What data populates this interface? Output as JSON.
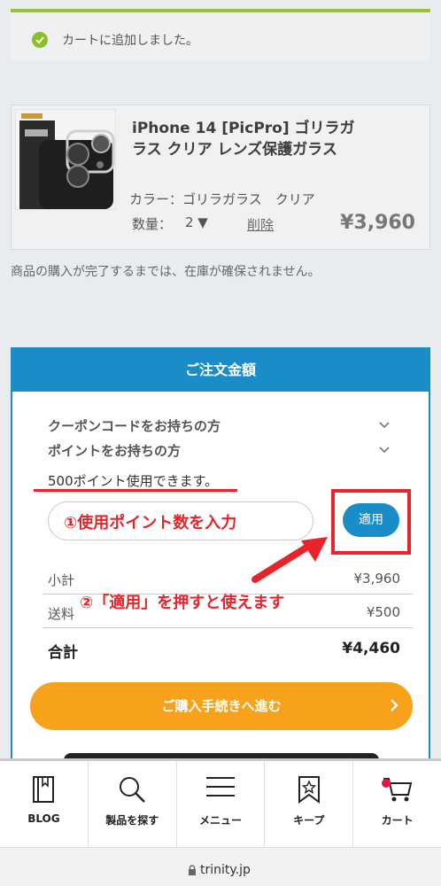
{
  "notice": {
    "message": "カートに追加しました。"
  },
  "product": {
    "name": "iPhone 14 [PicPro] ゴリラガラス クリア レンズ保護ガラス",
    "color": "カラー：ゴリラガラス　クリア",
    "qty_label": "数量：",
    "qty_value": "2 ▼",
    "delete_label": "削除",
    "price": "¥3,960"
  },
  "stock_note": "商品の購入が完了するまでは、在庫が確保されません。",
  "order": {
    "title": "ご注文金額",
    "coupon_label": "クーポンコードをお持ちの方",
    "points_label": "ポイントをお持ちの方",
    "points_available": "500ポイント使用できます。",
    "point_input_placeholder": "",
    "annotation_1": "①使用ポイント数を入力",
    "apply_label": "適用",
    "annotation_2": "②「適用」を押すと使えます",
    "subtotal_label": "小計",
    "subtotal_value": "¥3,960",
    "shipping_label": "送料",
    "shipping_value": "¥500",
    "total_label": "合計",
    "total_value": "¥4,460",
    "proceed_label": "ご購入手続きへ進む"
  },
  "tabbar": {
    "items": [
      {
        "label": "BLOG",
        "icon": "book-icon"
      },
      {
        "label": "製品を探す",
        "icon": "search-icon"
      },
      {
        "label": "メニュー",
        "icon": "menu-icon"
      },
      {
        "label": "キープ",
        "icon": "bookmark-star-icon"
      },
      {
        "label": "カート",
        "icon": "cart-icon"
      }
    ]
  },
  "browser": {
    "url": "trinity.jp"
  },
  "colors": {
    "accent_blue": "#1a8dc9",
    "cta_orange": "#f8a21b",
    "annotation_red": "#e8232a",
    "success_green": "#8dbd2b"
  }
}
